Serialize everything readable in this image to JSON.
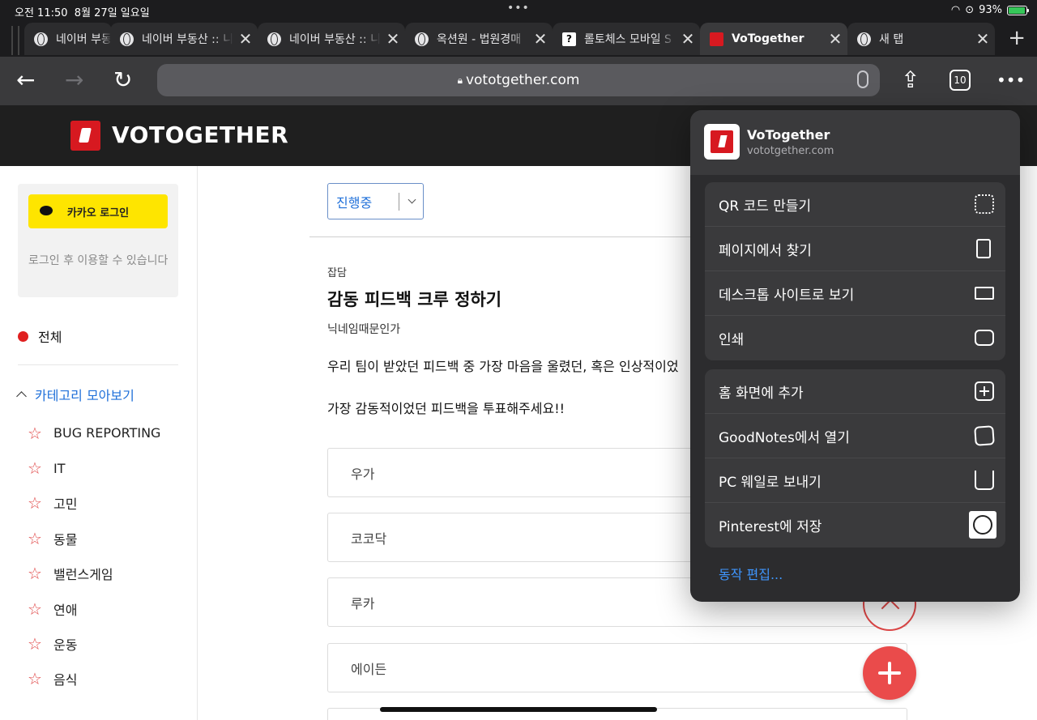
{
  "status": {
    "time": "오전 11:50",
    "date": "8월 27일 일요일",
    "dots": "•••",
    "battery": "93%",
    "battery_level": 0.93
  },
  "tabs": [
    {
      "title": "네이버 부동",
      "icon": "globe-icon"
    },
    {
      "title": "네이버 부동산 :: 니",
      "icon": "globe-icon"
    },
    {
      "title": "네이버 부동산 :: 니",
      "icon": "globe-icon"
    },
    {
      "title": "옥션원 - 법원경매",
      "icon": "globe-icon"
    },
    {
      "title": "롤토체스 모바일 S",
      "icon": "question-icon"
    },
    {
      "title": "VoTogether",
      "icon": "votogether-favicon",
      "active": true
    },
    {
      "title": "새 탭",
      "icon": "globe-icon"
    }
  ],
  "toolbar": {
    "url": "vototgether.com",
    "tab_count": "10",
    "back_glyph": "←",
    "forward_glyph": "→",
    "reload_glyph": "↻",
    "share_glyph": "⇪",
    "more_glyph": "•••",
    "close_glyph": "✕",
    "add_glyph": "+"
  },
  "site": {
    "logo": "VOTOGETHER"
  },
  "sidebar": {
    "kakao_login": "카카오 로그인",
    "login_note": "로그인 후 이용할 수 있습니다",
    "all": "전체",
    "category_header": "카테고리 모아보기",
    "star": "☆",
    "categories": [
      "BUG REPORTING",
      "IT",
      "고민",
      "동물",
      "밸런스게임",
      "연애",
      "운동",
      "음식"
    ]
  },
  "main": {
    "status_filter": "진행중",
    "post": {
      "category": "잡담",
      "title": "감동 피드백 크루 정하기",
      "author": "닉네임때문인가",
      "body_line1": "우리 팀이 받았던 피드백 중 가장 마음을 울렸던, 혹은 인상적이었",
      "body_line2": "가장 감동적이었던 피드백을 투표해주세요!!"
    },
    "options": [
      "우가",
      "코코닥",
      "루카",
      "에이든"
    ]
  },
  "share_sheet": {
    "site_title": "VoTogether",
    "site_url": "vototgether.com",
    "group1": [
      "QR 코드 만들기",
      "페이지에서 찾기",
      "데스크톱 사이트로 보기",
      "인쇄"
    ],
    "group2": [
      "홈 화면에 추가",
      "GoodNotes에서 열기",
      "PC 웨일로 보내기",
      "Pinterest에 저장"
    ],
    "edit_actions": "동작 편집..."
  }
}
